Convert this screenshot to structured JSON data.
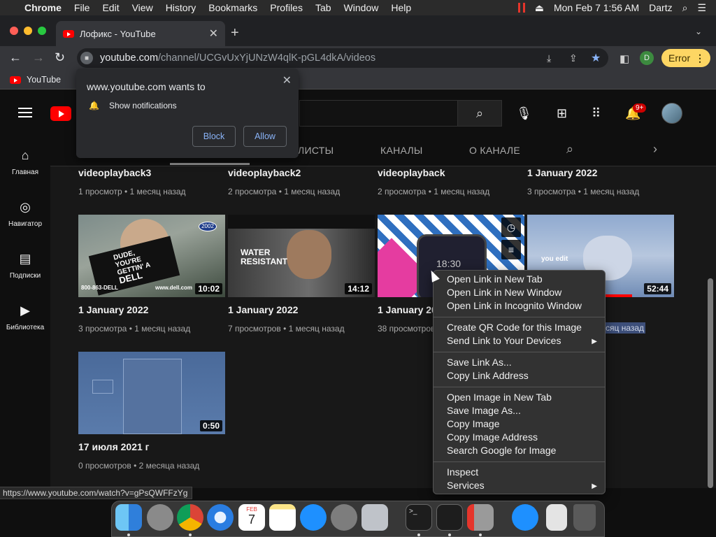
{
  "menubar": {
    "apple": "",
    "app": "Chrome",
    "items": [
      "File",
      "Edit",
      "View",
      "History",
      "Bookmarks",
      "Profiles",
      "Tab",
      "Window",
      "Help"
    ],
    "datetime": "Mon Feb 7  1:56 AM",
    "user": "Dartz"
  },
  "tab": {
    "title": "Лофикс - YouTube",
    "close": "✕",
    "new_tab": "+"
  },
  "omnibox": {
    "host": "youtube.com",
    "path": "/channel/UCGvUxYjUNzW4qlK-pGL4dkA/videos"
  },
  "profile_initial": "D",
  "error_button": {
    "label": "Error",
    "dots": "⋮"
  },
  "bookmarks": [
    {
      "label": "YouTube"
    }
  ],
  "notification": {
    "title": "www.youtube.com wants to",
    "permission": "Show notifications",
    "block": "Block",
    "allow": "Allow"
  },
  "youtube": {
    "notif_badge": "9+",
    "guide": [
      {
        "label": "Главная",
        "icon": "home-icon"
      },
      {
        "label": "Навигатор",
        "icon": "explore-icon"
      },
      {
        "label": "Подписки",
        "icon": "subscriptions-icon"
      },
      {
        "label": "Библиотека",
        "icon": "library-icon"
      }
    ],
    "channel_tabs": [
      "ЛИСТЫ",
      "КАНАЛЫ",
      "О КАНАЛЕ"
    ],
    "videos_row1": [
      {
        "title": "videoplayback3",
        "meta": "1 просмотр • 1 месяц назад"
      },
      {
        "title": "videoplayback2",
        "meta": "2 просмотра • 1 месяц назад"
      },
      {
        "title": "videoplayback",
        "meta": "2 просмотра • 1 месяц назад"
      },
      {
        "title": "1 January 2022",
        "meta": "3 просмотра • 1 месяц назад"
      }
    ],
    "videos_row2": [
      {
        "title": "1 January 2022",
        "meta": "3 просмотра • 1 месяц назад",
        "duration": "10:02"
      },
      {
        "title": "1 January 2022",
        "meta": "7 просмотров • 1 месяц назад",
        "duration": "14:12"
      },
      {
        "title": "1 January 20",
        "meta": "38 просмотров",
        "duration": ""
      },
      {
        "title": "",
        "meta": "сяц назад",
        "duration": "52:44"
      }
    ],
    "videos_row3": [
      {
        "title": "17 июля 2021 г",
        "meta": "0 просмотров • 2 месяца назад",
        "duration": "0:50"
      }
    ],
    "thumb_text": {
      "dell_line1": "DUDE,",
      "dell_line2": "YOU'RE",
      "dell_line3": "GETTIN' A",
      "dell_brand": "DELL",
      "dell_phone": "800-863-DELL",
      "dell_url": "www.dell.com",
      "dell_badge": "2002",
      "water": "WATER",
      "resistant": "RESISTANT",
      "phone_clock": "18:30",
      "you_edit": "you edit"
    }
  },
  "status_url": "https://www.youtube.com/watch?v=gPsQWFFzYg",
  "context_menu": {
    "group1": [
      "Open Link in New Tab",
      "Open Link in New Window",
      "Open Link in Incognito Window"
    ],
    "group2": [
      "Create QR Code for this Image",
      "Send Link to Your Devices"
    ],
    "group3": [
      "Save Link As...",
      "Copy Link Address"
    ],
    "group4": [
      "Open Image in New Tab",
      "Save Image As...",
      "Copy Image",
      "Copy Image Address",
      "Search Google for Image"
    ],
    "group5": [
      "Inspect",
      "Services"
    ]
  },
  "dock": {
    "calendar_month": "FEB",
    "calendar_day": "7",
    "terminal_prompt": ">_",
    "icons": [
      "finder-icon",
      "launchpad-icon",
      "chrome-icon",
      "safari-icon",
      "calendar-icon",
      "notes-icon",
      "app-store-icon",
      "system-preferences-icon",
      "roblox-icon",
      "terminal-icon",
      "terminal-2-icon",
      "screen-recorder-icon",
      "app-store-2-icon",
      "file-icon",
      "trash-icon"
    ]
  },
  "colors": {
    "youtube_red": "#ff0000",
    "error_yellow": "#fdd663",
    "link_blue": "#8ab4f8",
    "bookmark_star": "#8ab4f8"
  }
}
